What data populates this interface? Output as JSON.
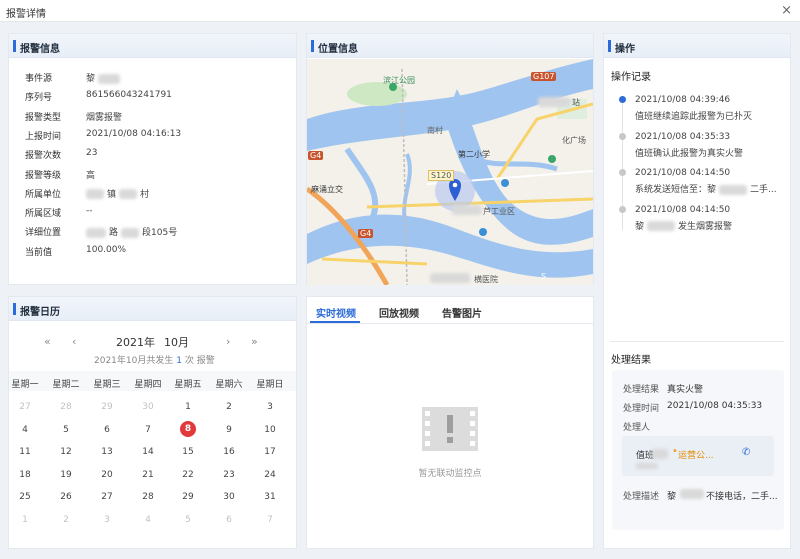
{
  "window": {
    "title": "报警详情",
    "close_icon": "×"
  },
  "info_panel": {
    "title": "报警信息",
    "rows": [
      {
        "key": "事件源",
        "value": "黎"
      },
      {
        "key": "序列号",
        "value": "861566043241791"
      },
      {
        "key": "报警类型",
        "value": "烟雾报警"
      },
      {
        "key": "上报时间",
        "value": "2021/10/08 04:16:13"
      },
      {
        "key": "报警次数",
        "value": "23"
      },
      {
        "key": "报警等级",
        "value": "高"
      },
      {
        "key": "所属单位",
        "value": "镇",
        "value2": "村"
      },
      {
        "key": "所属区域",
        "value": "--"
      },
      {
        "key": "详细位置",
        "value": "路",
        "value2": "段105号"
      },
      {
        "key": "当前值",
        "value": "100.00%"
      }
    ]
  },
  "location_panel": {
    "title": "位置信息",
    "map_labels": {
      "park": "滨江公园",
      "g107": "G107",
      "station": "站",
      "plaza": "化广场",
      "school": "第二小学",
      "village": "南村",
      "s120": "S120",
      "g4a": "G4",
      "g4b": "G4",
      "masha": "麻涌立交",
      "industry": "芦工业区",
      "hospital": "横医院",
      "s": "S"
    }
  },
  "calendar_panel": {
    "title": "报警日历",
    "year": "2021年",
    "month": "10月",
    "summary_prefix": "2021年10月共发生",
    "summary_count": "1",
    "summary_suffix": "次 报警",
    "nav": {
      "prev_year": "«",
      "prev_month": "‹",
      "next_month": "›",
      "next_year": "»"
    },
    "weekdays": [
      "星期一",
      "星期二",
      "星期三",
      "星期四",
      "星期五",
      "星期六",
      "星期日"
    ],
    "weeks": [
      [
        "27",
        "28",
        "29",
        "30",
        "1",
        "2",
        "3"
      ],
      [
        "4",
        "5",
        "6",
        "7",
        "8",
        "9",
        "10"
      ],
      [
        "11",
        "12",
        "13",
        "14",
        "15",
        "16",
        "17"
      ],
      [
        "18",
        "19",
        "20",
        "21",
        "22",
        "23",
        "24"
      ],
      [
        "25",
        "26",
        "27",
        "28",
        "29",
        "30",
        "31"
      ],
      [
        "1",
        "2",
        "3",
        "4",
        "5",
        "6",
        "7"
      ]
    ],
    "selected": "8"
  },
  "video_panel": {
    "tabs": [
      "实时视频",
      "回放视频",
      "告警图片"
    ],
    "active_tab": 0,
    "empty_text": "暂无联动监控点"
  },
  "ops_panel": {
    "title": "操作",
    "records_title": "操作记录",
    "records": [
      {
        "time": "2021/10/08 04:39:46",
        "text": "值班继续追踪此报警为已扑灭",
        "active": true
      },
      {
        "time": "2021/10/08 04:35:33",
        "text": "值班确认此报警为真实火警",
        "active": false
      },
      {
        "time": "2021/10/08 04:14:50",
        "text": "系统发送短信至：黎",
        "text2": "二手...",
        "active": false
      },
      {
        "time": "2021/10/08 04:14:50",
        "text": "黎",
        "text2": "发生烟雾报警",
        "active": false
      }
    ],
    "result_title": "处理结果",
    "result": {
      "k1": "处理结果",
      "v1": "真实火警",
      "k2": "处理时间",
      "v2": "2021/10/08 04:35:33",
      "k3": "处理人",
      "handler_name": "值班",
      "handler_role": "运营公...",
      "k4": "处理描述",
      "v4": "黎",
      "v4b": "不接电话，二手..."
    },
    "accent": "#2c6bd8"
  }
}
